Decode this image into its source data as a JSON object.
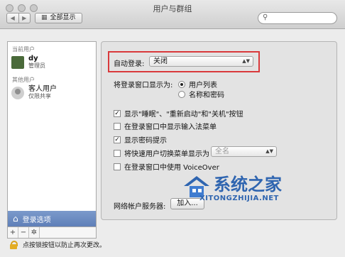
{
  "window": {
    "title": "用户与群组"
  },
  "toolbar": {
    "back_glyph": "◀",
    "forward_glyph": "▶",
    "show_all_label": "全部显示",
    "grid_icon": "▦",
    "search_placeholder": ""
  },
  "sidebar": {
    "current_users_header": "当前用户",
    "current_user": {
      "name": "dy",
      "role": "管理员"
    },
    "other_users_header": "其他用户",
    "guest_user": {
      "name": "客人用户",
      "role": "仅限共享"
    },
    "login_options_label": "登录选项",
    "tools": {
      "add": "+",
      "remove": "−",
      "gear": "✲"
    }
  },
  "main": {
    "auto_login_label": "自动登录:",
    "auto_login_value": "关闭",
    "display_window_as_label": "将登录窗口显示为:",
    "radio_user_list": "用户列表",
    "radio_name_password": "名称和密码",
    "check_sleep": "显示\"睡眠\"、\"重新启动\"和\"关机\"按钮",
    "check_input_menu": "在登录窗口中显示输入法菜单",
    "check_password_hints": "显示密码提示",
    "check_fast_switch": "将快速用户切换菜单显示为",
    "fast_switch_value": "全名",
    "check_voiceover": "在登录窗口中使用 VoiceOver",
    "network_server_label": "网络帐户服务器:",
    "join_button": "加入..."
  },
  "footer": {
    "lock_text": "点按锁按钮以防止再次更改。"
  },
  "watermark": {
    "title": "系统之家",
    "url": "XITONGZHIJIA.NET"
  }
}
